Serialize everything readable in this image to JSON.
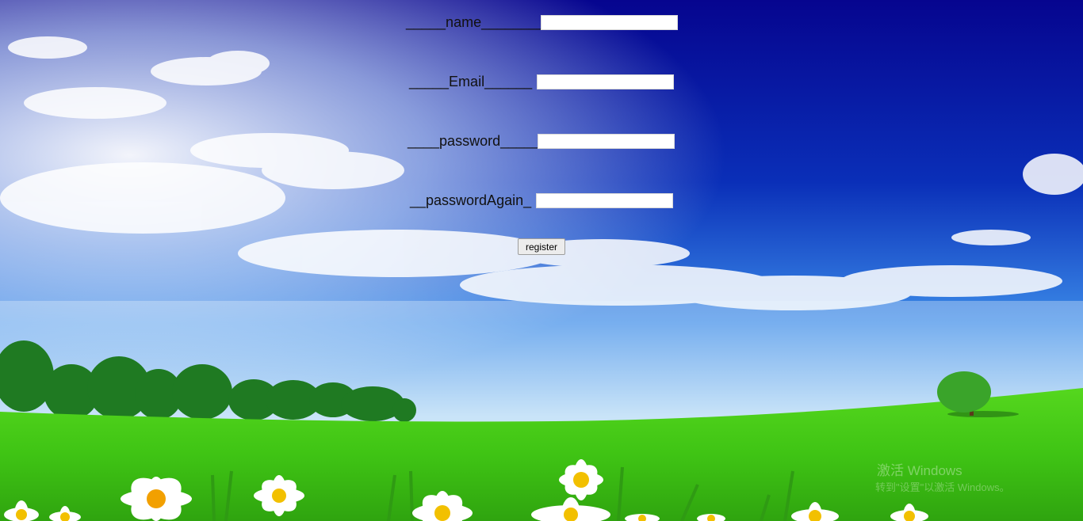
{
  "form": {
    "name_label": "_____name________",
    "email_label": "_____Email______",
    "password_label": "____password_____",
    "password_again_label": "__passwordAgain_",
    "name_value": "",
    "email_value": "",
    "password_value": "",
    "password_again_value": "",
    "register_label": "register"
  },
  "watermark": {
    "line1": "激活 Windows",
    "line2": "转到\"设置\"以激活 Windows。"
  },
  "scene": {
    "sky_top_color": "#06058f",
    "sky_mid_color": "#2d7fe6",
    "grass_color": "#4fd01e",
    "tree_color": "#1f7a22",
    "flower_color": "#ffffff",
    "flower_center_color": "#f2c000"
  }
}
